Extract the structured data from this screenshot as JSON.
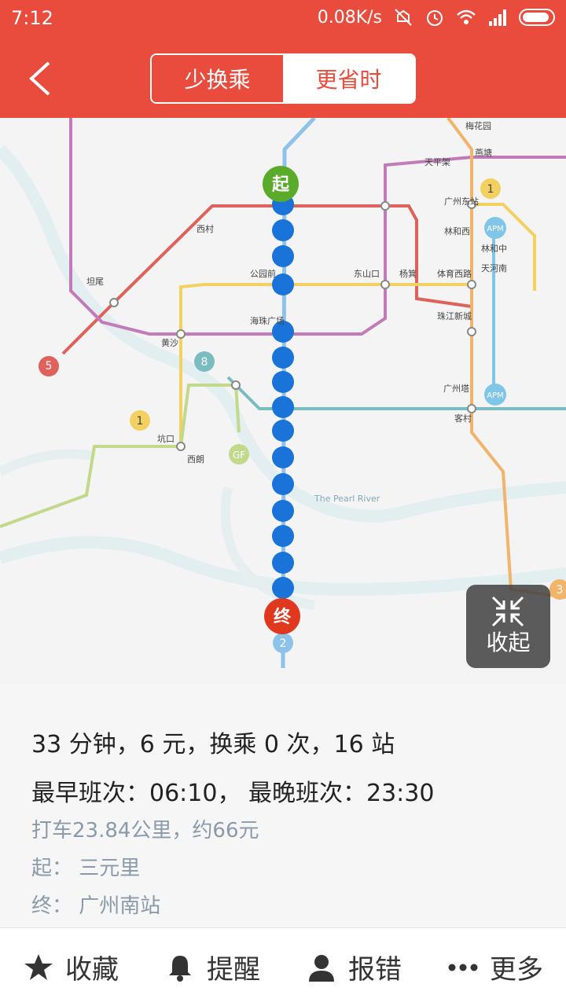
{
  "status_bar": {
    "time": "7:12",
    "net_speed": "0.08K/s",
    "icons": [
      "mute-icon",
      "alarm-icon",
      "wifi-icon",
      "signal-icon",
      "battery-icon"
    ]
  },
  "header": {
    "tabs": [
      {
        "label": "少换乘",
        "active": true
      },
      {
        "label": "更省时",
        "active": false
      }
    ],
    "accent_color": "#e94b3c"
  },
  "map": {
    "start_marker": "起",
    "end_marker": "终",
    "line_badges": [
      "5",
      "8",
      "1",
      "1",
      "2",
      "3",
      "GF",
      "APM",
      "APM"
    ],
    "stations": {
      "guangzhou_east": "广州东站",
      "linhexi": "林和西",
      "linhe_central": "林和中",
      "tianhe_south": "天河南",
      "huangpu": "黄沙",
      "xicun": "西村",
      "gongyuanqian": "公园前",
      "dongshankou": "东山口",
      "yangji": "杨箕",
      "tiyu_xilu": "体育西路",
      "zhujiang_xincheng": "珠江新城",
      "guangzhou_ta": "广州塔",
      "kecun": "客村",
      "haizhu_guangchang": "海珠广场",
      "xilang": "西朗",
      "kengkou": "坑口",
      "tanwei": "坦尾",
      "tianhe_ke": "天平架",
      "meihuacun": "梅花园",
      "yantang": "燕塘",
      "pearl_river": "The Pearl River"
    },
    "collapse_label": "收起",
    "route_color": "#1a73d9"
  },
  "info": {
    "summary": "33 分钟，6 元，换乘 0 次，16 站",
    "schedule": "最早班次：06:10，  最晚班次：23:30",
    "taxi": "打车23.84公里，约66元",
    "from": "起：  三元里",
    "to": "终：  广州南站"
  },
  "bottom_bar": {
    "items": [
      {
        "label": "收藏",
        "icon": "star-icon"
      },
      {
        "label": "提醒",
        "icon": "bell-icon"
      },
      {
        "label": "报错",
        "icon": "user-icon"
      },
      {
        "label": "更多",
        "icon": "more-icon"
      }
    ]
  }
}
